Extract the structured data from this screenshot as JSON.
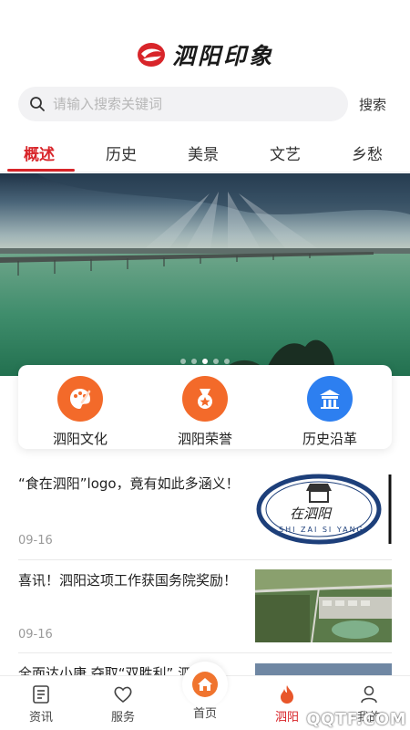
{
  "app": {
    "title": "泗阳印象"
  },
  "search": {
    "placeholder": "请输入搜索关键词",
    "button_label": "搜索"
  },
  "tabs": [
    {
      "label": "概述",
      "active": true
    },
    {
      "label": "历史",
      "active": false
    },
    {
      "label": "美景",
      "active": false
    },
    {
      "label": "文艺",
      "active": false
    },
    {
      "label": "乡愁",
      "active": false
    }
  ],
  "carousel": {
    "pages": 5,
    "current": 3
  },
  "quick_links": [
    {
      "label": "泗阳文化",
      "icon": "palette-icon",
      "color": "#f36a2a"
    },
    {
      "label": "泗阳荣誉",
      "icon": "medal-icon",
      "color": "#f36a2a"
    },
    {
      "label": "历史沿革",
      "icon": "temple-icon",
      "color": "#2d7ff0"
    }
  ],
  "news": [
    {
      "title": "“食在泗阳”logo，竟有如此多涵义！",
      "date": "09-16",
      "image": "logo-thumbnail"
    },
    {
      "title": "喜讯！泗阳这项工作获国务院奖励！",
      "date": "09-16",
      "image": "aerial-thumbnail"
    },
    {
      "title": "全面达小康 夺取“双胜利” 泗阳",
      "date": "",
      "image": "partial-thumbnail"
    }
  ],
  "thumb_logo_text": {
    "main": "在泗阳",
    "ring": "SHI ZAI SI YANG"
  },
  "bottom_nav": [
    {
      "label": "资讯",
      "icon": "news-icon",
      "active": false
    },
    {
      "label": "服务",
      "icon": "heart-icon",
      "active": false
    },
    {
      "label": "首页",
      "icon": "home-icon",
      "active": false
    },
    {
      "label": "泗阳",
      "icon": "flame-icon",
      "active": true
    },
    {
      "label": "我的",
      "icon": "user-icon",
      "active": false
    }
  ],
  "watermark": "QQTF.COM",
  "colors": {
    "accent": "#d8252a",
    "orange": "#f36a2a",
    "blue": "#2d7ff0"
  }
}
